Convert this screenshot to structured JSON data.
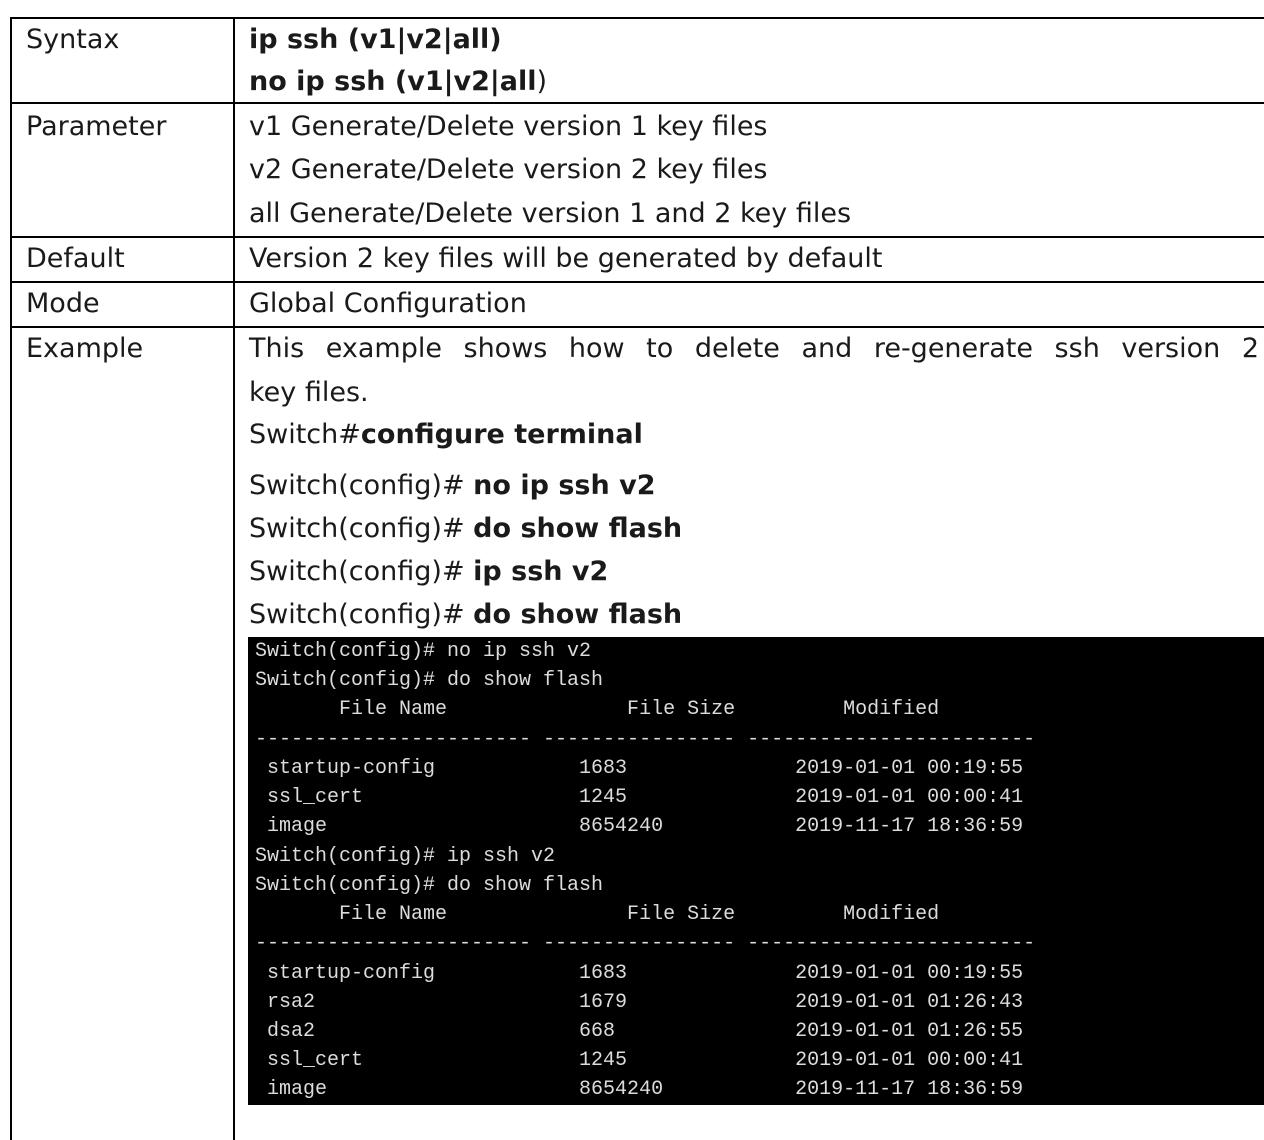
{
  "rows": {
    "syntax": {
      "label": "Syntax",
      "line1": "ip ssh (v1|v2|all)",
      "line2_bold": "no ip ssh (v1|v2|all",
      "line2_tail": ")"
    },
    "parameter": {
      "label": "Parameter",
      "lines": [
        "v1 Generate/Delete version 1 key files",
        "v2 Generate/Delete version 2 key files",
        "all Generate/Delete version 1 and 2 key files"
      ]
    },
    "default": {
      "label": "Default",
      "text": "Version 2 key files will be generated by default"
    },
    "mode": {
      "label": "Mode",
      "text": "Global Configuration"
    },
    "example": {
      "label": "Example",
      "desc_line1": "This example shows how to delete and re-generate ssh version 2",
      "desc_line2": "key files.",
      "commands": [
        {
          "prompt": "Switch#",
          "cmd": "configure terminal"
        },
        {
          "prompt": "Switch(config)# ",
          "cmd": "no ip ssh v2"
        },
        {
          "prompt": "Switch(config)# ",
          "cmd": "do show flash"
        },
        {
          "prompt": "Switch(config)# ",
          "cmd": "ip ssh v2"
        },
        {
          "prompt": "Switch(config)# ",
          "cmd": "do show flash"
        }
      ]
    }
  },
  "terminal": {
    "lines": [
      "Switch(config)# no ip ssh v2",
      "Switch(config)# do show flash",
      "       File Name               File Size         Modified",
      "----------------------- ---------------- ------------------------",
      " startup-config            1683              2019-01-01 00:19:55",
      " ssl_cert                  1245              2019-01-01 00:00:41",
      " image                     8654240           2019-11-17 18:36:59",
      "Switch(config)# ip ssh v2",
      "Switch(config)# do show flash",
      "       File Name               File Size         Modified",
      "----------------------- ---------------- ------------------------",
      " startup-config            1683              2019-01-01 00:19:55",
      " rsa2                      1679              2019-01-01 01:26:43",
      " dsa2                      668               2019-01-01 01:26:55",
      " ssl_cert                  1245              2019-01-01 00:00:41",
      " image                     8654240           2019-11-17 18:36:59"
    ]
  }
}
